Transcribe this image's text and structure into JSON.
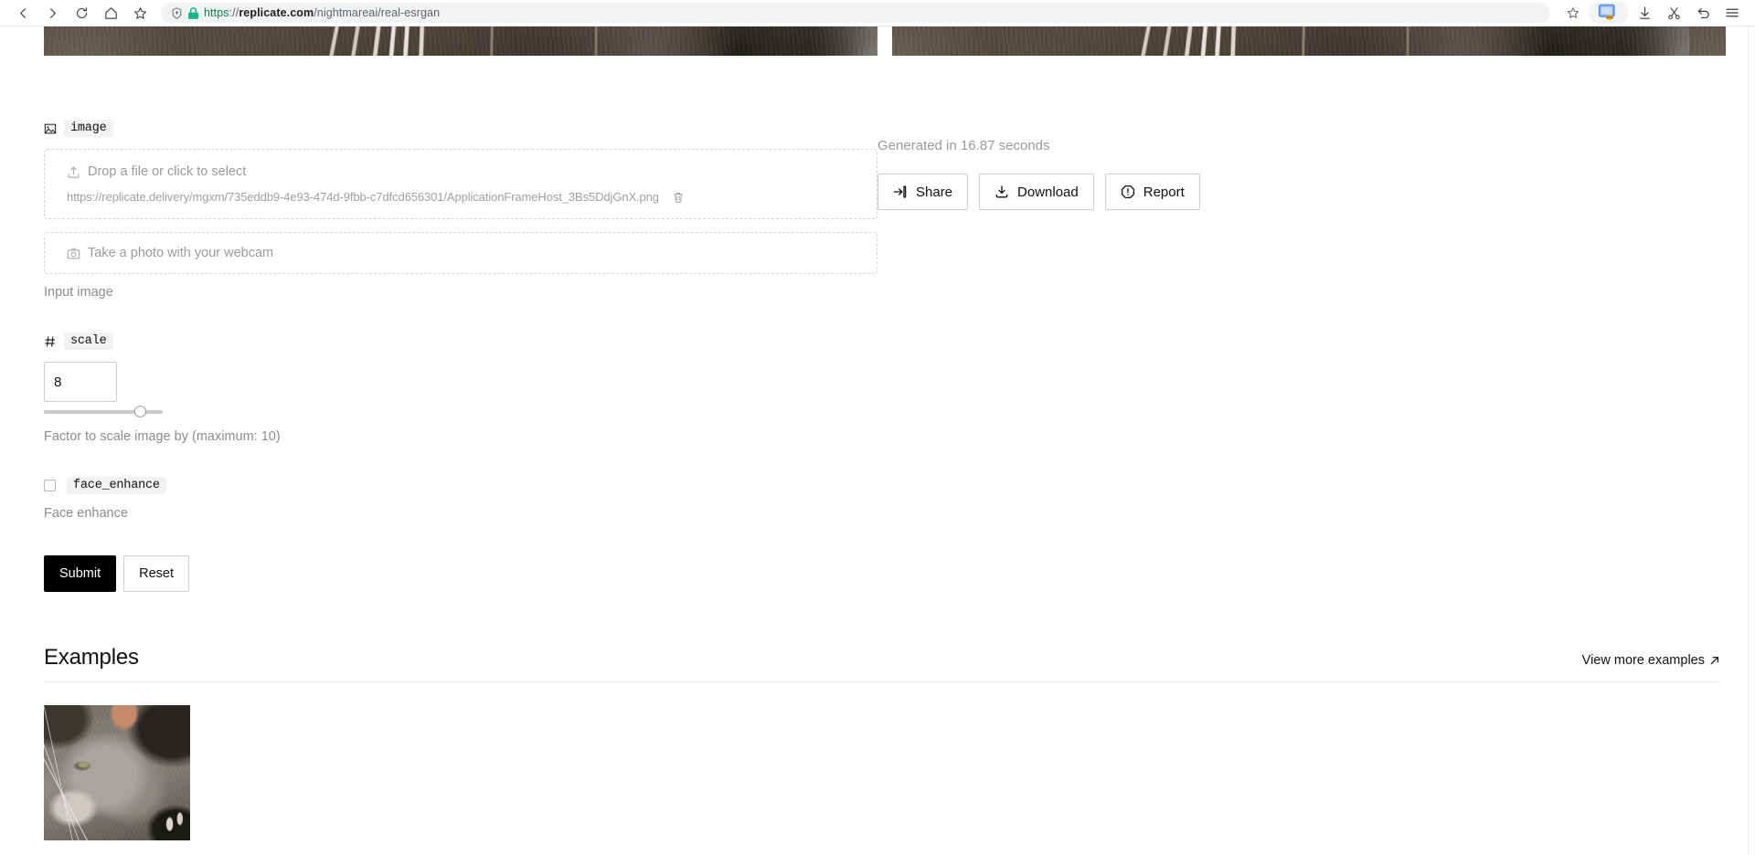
{
  "browser": {
    "nav": {
      "back": "back-button",
      "forward": "forward-button",
      "reload": "reload-button",
      "home": "home-button",
      "bookmark": "bookmark-star-button"
    },
    "url": {
      "scheme": "https",
      "separator": "://",
      "host": "replicate.com",
      "path": "/nightmareai/real-esrgan",
      "full": "https://replicate.com/nightmareai/real-esrgan"
    },
    "toolbar_icons": [
      "star-icon",
      "screenshot-icon",
      "downloads-icon",
      "cut-icon",
      "history-back-icon",
      "menu-icon"
    ]
  },
  "form": {
    "image_field": {
      "key": "image",
      "dropzone_label": "Drop a file or click to select",
      "file_url": "https://replicate.delivery/mgxm/735eddb9-4e93-474d-9fbb-c7dfcd656301/ApplicationFrameHost_3Bs5DdjGnX.png",
      "webcam_label": "Take a photo with your webcam",
      "help": "Input image"
    },
    "scale_field": {
      "key": "scale",
      "value": "8",
      "help": "Factor to scale image by (maximum: 10)",
      "slider_percent": 76,
      "min": 0,
      "max": 10
    },
    "face_enhance_field": {
      "key": "face_enhance",
      "checked": false,
      "help": "Face enhance"
    },
    "submit_label": "Submit",
    "reset_label": "Reset"
  },
  "result": {
    "generated_text": "Generated in 16.87 seconds",
    "actions": [
      {
        "label": "Share",
        "icon": "share-icon"
      },
      {
        "label": "Download",
        "icon": "download-icon"
      },
      {
        "label": "Report",
        "icon": "report-icon"
      }
    ]
  },
  "examples": {
    "title": "Examples",
    "view_more_label": "View more examples",
    "thumbnails": [
      "cat-example-thumbnail"
    ]
  },
  "colors": {
    "accent_green": "#0b8043",
    "primary_button": "#000000",
    "muted_text": "#9a9a9a",
    "border": "#d6d6d6"
  }
}
